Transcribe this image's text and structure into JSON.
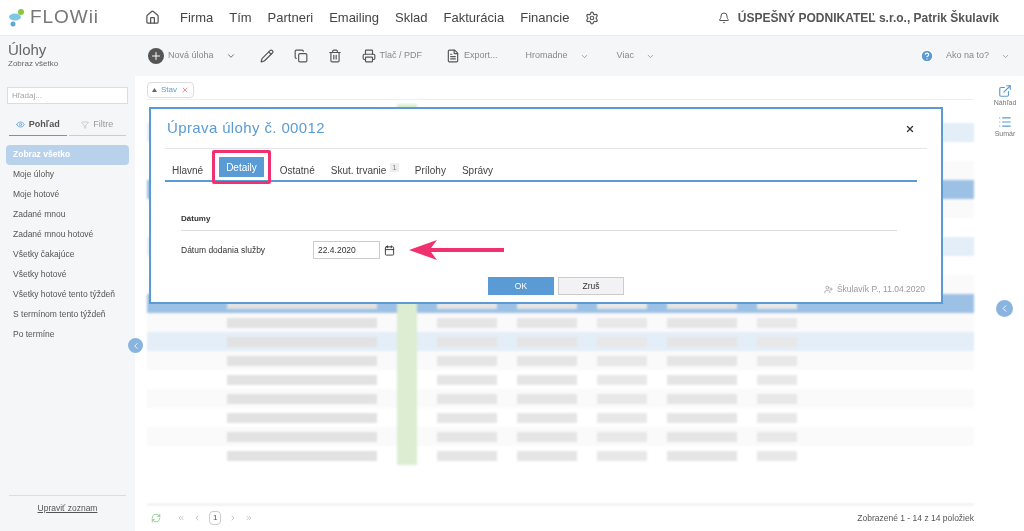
{
  "logo": "FLOWii",
  "nav": [
    "Firma",
    "Tím",
    "Partneri",
    "Emailing",
    "Sklad",
    "Fakturácia",
    "Financie"
  ],
  "company": "ÚSPEŠNÝ PODNIKATEĽ s.r.o., Patrik Škulavík",
  "page": {
    "title": "Úlohy",
    "subtitle": "Zobraz všetko"
  },
  "toolbar": {
    "new": "Nová úloha",
    "print": "Tlač / PDF",
    "export": "Export...",
    "bulk": "Hromadne",
    "more": "Viac",
    "help": "Ako na to?"
  },
  "sidebar": {
    "search_placeholder": "Hľadaj...",
    "tabs": [
      {
        "label": "Pohľad",
        "selected": true
      },
      {
        "label": "Filtre",
        "selected": false
      }
    ],
    "items": [
      {
        "label": "Zobraz všetko",
        "selected": true
      },
      {
        "label": "Moje úlohy",
        "selected": false
      },
      {
        "label": "Moje hotové",
        "selected": false
      },
      {
        "label": "Zadané mnou",
        "selected": false
      },
      {
        "label": "Zadané mnou hotové",
        "selected": false
      },
      {
        "label": "Všetky čakajúce",
        "selected": false
      },
      {
        "label": "Všetky hotové",
        "selected": false
      },
      {
        "label": "Všetky hotové tento týždeň",
        "selected": false
      },
      {
        "label": "S termínom tento týždeň",
        "selected": false
      },
      {
        "label": "Po termíne",
        "selected": false
      }
    ],
    "edit_link": "Upraviť zoznam"
  },
  "filter_chip": "Stav",
  "right_rail": [
    "Náhľad",
    "Sumár"
  ],
  "dialog": {
    "title": "Úprava úlohy č. 00012",
    "tabs": [
      {
        "label": "Hlavné",
        "selected": false
      },
      {
        "label": "Detaily",
        "selected": true,
        "highlighted": true
      },
      {
        "label": "Ostatné",
        "selected": false
      },
      {
        "label": "Skut. trvanie",
        "selected": false,
        "badge": "1"
      },
      {
        "label": "Prílohy",
        "selected": false
      },
      {
        "label": "Správy",
        "selected": false
      }
    ],
    "section": "Dátumy",
    "field_label": "Dátum dodania služby",
    "field_value": "22.4.2020",
    "ok": "OK",
    "cancel": "Zruš",
    "author": "Škulavík P., 11.04.2020"
  },
  "pager": {
    "page": "1",
    "summary": "Zobrazené 1 - 14 z 14 položiek"
  }
}
